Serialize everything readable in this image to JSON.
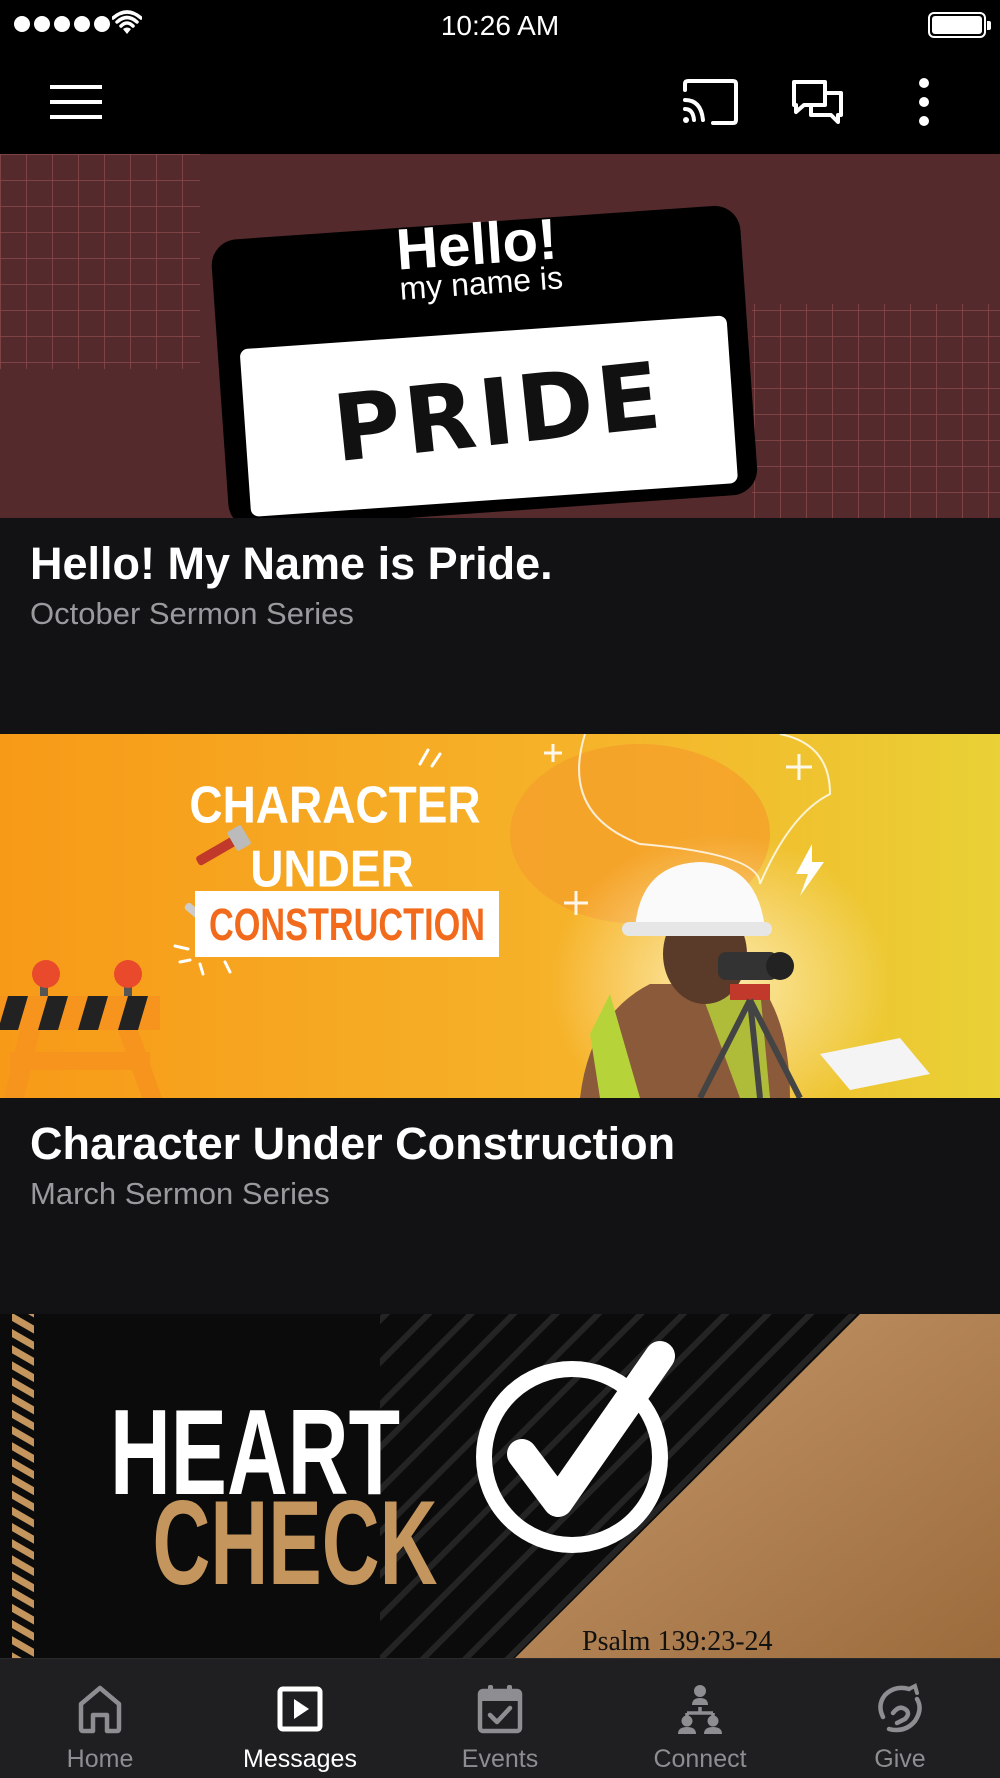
{
  "status_bar": {
    "time": "10:26 AM",
    "signal_dots": 5
  },
  "app_bar": {
    "menu_icon": "hamburger-menu-icon",
    "cast_icon": "cast-icon",
    "chat_icon": "chat-bubbles-icon",
    "more_icon": "more-vertical-icon"
  },
  "feed": {
    "cards": [
      {
        "title": "Hello! My Name is Pride.",
        "subtitle": "October Sermon Series",
        "banner": {
          "hello": "Hello!",
          "my_name_is": "my name is",
          "name": "PRIDE",
          "bg_color": "#542a2c"
        }
      },
      {
        "title": "Character Under Construction",
        "subtitle": "March Sermon Series",
        "banner": {
          "line1": "CHARACTER",
          "line2": "UNDER",
          "line3": "CONSTRUCTION",
          "accent_color": "#f26b1d"
        }
      },
      {
        "title": "",
        "subtitle": "",
        "banner": {
          "line1": "HEART",
          "line2": "CHECK",
          "verse": "Psalm 139:23-24",
          "gold_color": "#c4965e"
        }
      }
    ]
  },
  "bottom_nav": {
    "items": [
      {
        "label": "Home",
        "icon": "home-icon",
        "active": false
      },
      {
        "label": "Messages",
        "icon": "play-square-icon",
        "active": true
      },
      {
        "label": "Events",
        "icon": "calendar-check-icon",
        "active": false
      },
      {
        "label": "Connect",
        "icon": "people-connect-icon",
        "active": false
      },
      {
        "label": "Give",
        "icon": "give-hand-icon",
        "active": false
      }
    ]
  }
}
